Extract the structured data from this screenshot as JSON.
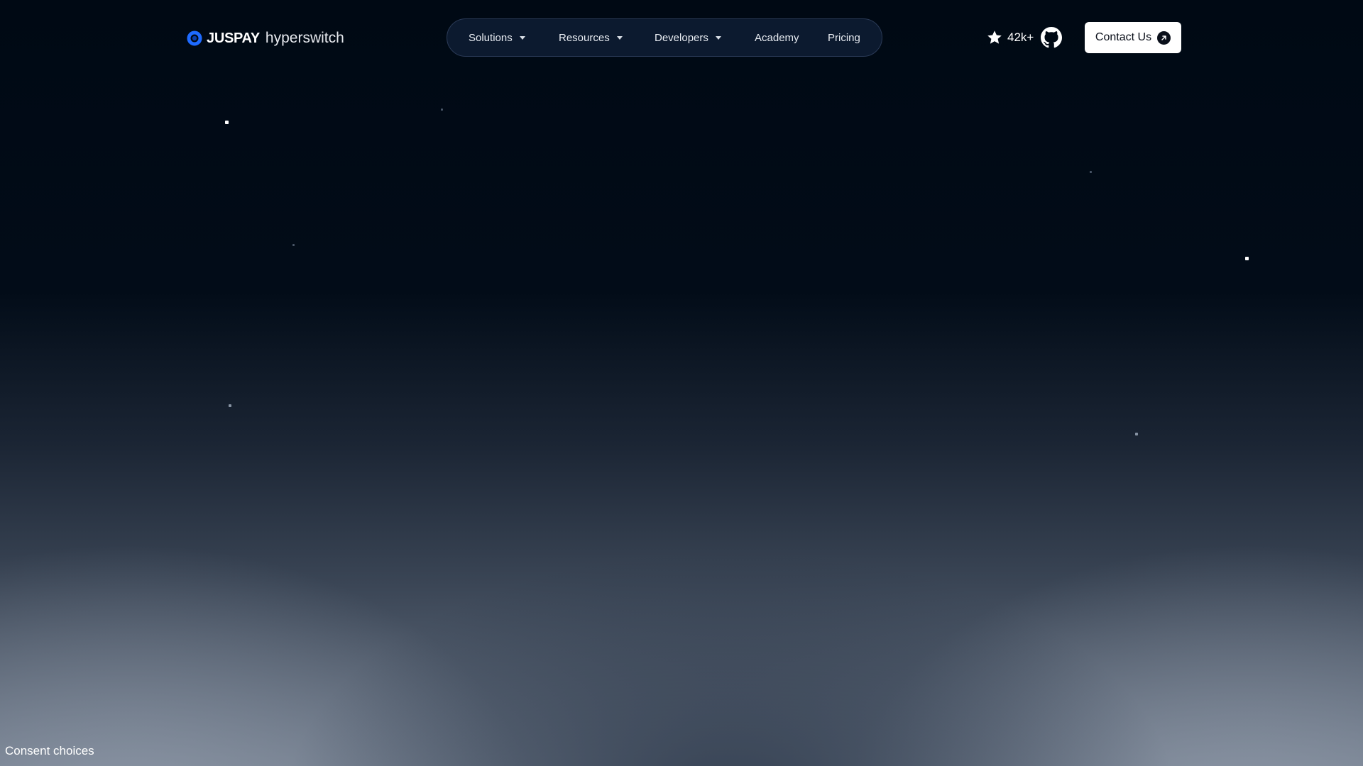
{
  "header": {
    "logo": {
      "brand": "JUSPAY",
      "product": "hyperswitch",
      "mark_color": "#1e6bff"
    },
    "nav": {
      "items": [
        {
          "label": "Solutions",
          "has_dropdown": true
        },
        {
          "label": "Resources",
          "has_dropdown": true
        },
        {
          "label": "Developers",
          "has_dropdown": true
        },
        {
          "label": "Academy",
          "has_dropdown": false
        },
        {
          "label": "Pricing",
          "has_dropdown": false
        }
      ]
    },
    "github_stars": {
      "icon": "star-icon",
      "label": "42k+"
    },
    "github_icon": "github-icon",
    "contact_button": {
      "label": "Contact Us",
      "icon": "arrow-up-right-icon"
    }
  },
  "footer": {
    "consent_label": "Consent choices"
  },
  "colors": {
    "background_top": "#000914",
    "background_bottom": "#6b7686",
    "nav_pill": "#0c1a2f",
    "button_bg": "#ffffff",
    "button_text": "#0a0f1a"
  }
}
